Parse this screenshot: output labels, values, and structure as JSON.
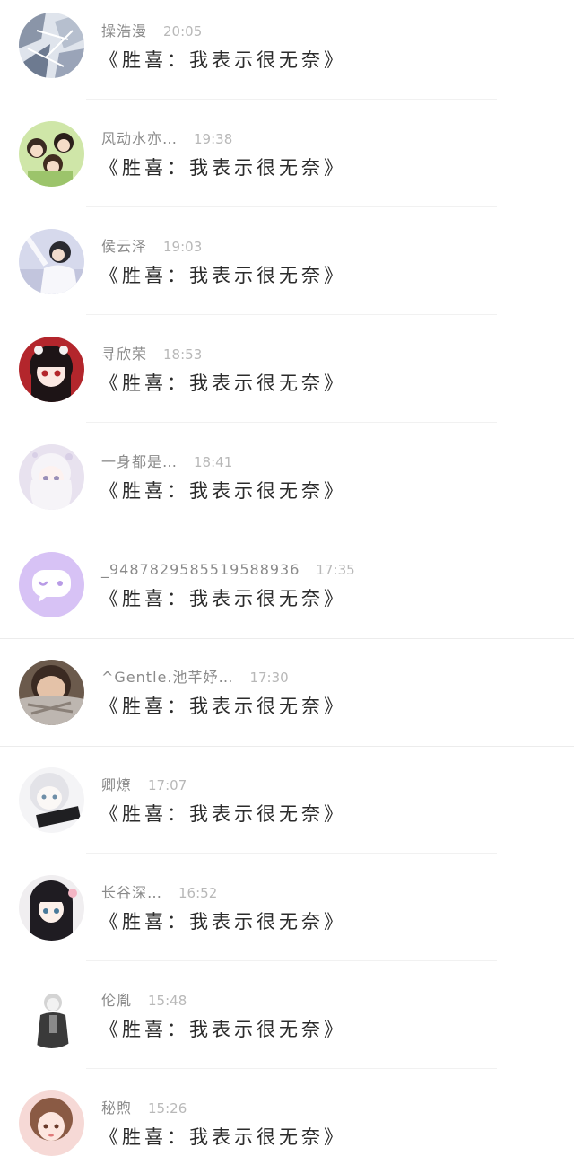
{
  "comments": [
    {
      "name": "操浩漫",
      "time": "20:05",
      "message": "《胜喜：我表示很无奈》",
      "avatar_icon": "avatar-cracked-white-icon",
      "avatar_color": "#8a95a8"
    },
    {
      "name": "风动水亦…",
      "time": "19:38",
      "message": "《胜喜：我表示很无奈》",
      "avatar_icon": "avatar-anime-group-icon",
      "avatar_color": "#9cc46b"
    },
    {
      "name": "侯云泽",
      "time": "19:03",
      "message": "《胜喜：我表示很无奈》",
      "avatar_icon": "avatar-girl-photo-icon",
      "avatar_color": "#c9cce0"
    },
    {
      "name": "寻欣荣",
      "time": "18:53",
      "message": "《胜喜：我表示很无奈》",
      "avatar_icon": "avatar-anime-red-girl-icon",
      "avatar_color": "#b3262c"
    },
    {
      "name": "一身都是…",
      "time": "18:41",
      "message": "《胜喜：我表示很无奈》",
      "avatar_icon": "avatar-anime-white-hair-icon",
      "avatar_color": "#d8cfe6"
    },
    {
      "name": "_9487829585519588936",
      "time": "17:35",
      "message": "《胜喜：我表示很无奈》",
      "avatar_icon": "avatar-default-chat-icon",
      "avatar_color": "#d7c2f5"
    },
    {
      "name": "^Gentle.池芊妤…",
      "time": "17:30",
      "message": "《胜喜：我表示很无奈》",
      "avatar_icon": "avatar-scarf-photo-icon",
      "avatar_color": "#7a6a5c"
    },
    {
      "name": "卿燎",
      "time": "17:07",
      "message": "《胜喜：我表示很无奈》",
      "avatar_icon": "avatar-anime-white-boy-icon",
      "avatar_color": "#e6e6ea"
    },
    {
      "name": "长谷深…",
      "time": "16:52",
      "message": "《胜喜：我表示很无奈》",
      "avatar_icon": "avatar-anime-black-hair-icon",
      "avatar_color": "#2a2a30"
    },
    {
      "name": "伦胤",
      "time": "15:48",
      "message": "《胜喜：我表示很无奈》",
      "avatar_icon": "avatar-sketch-boy-icon",
      "avatar_color": "#d8d8d8"
    },
    {
      "name": "秘煦",
      "time": "15:26",
      "message": "《胜喜：我表示很无奈》",
      "avatar_icon": "avatar-anime-pink-girl-icon",
      "avatar_color": "#f0c7c4"
    }
  ]
}
